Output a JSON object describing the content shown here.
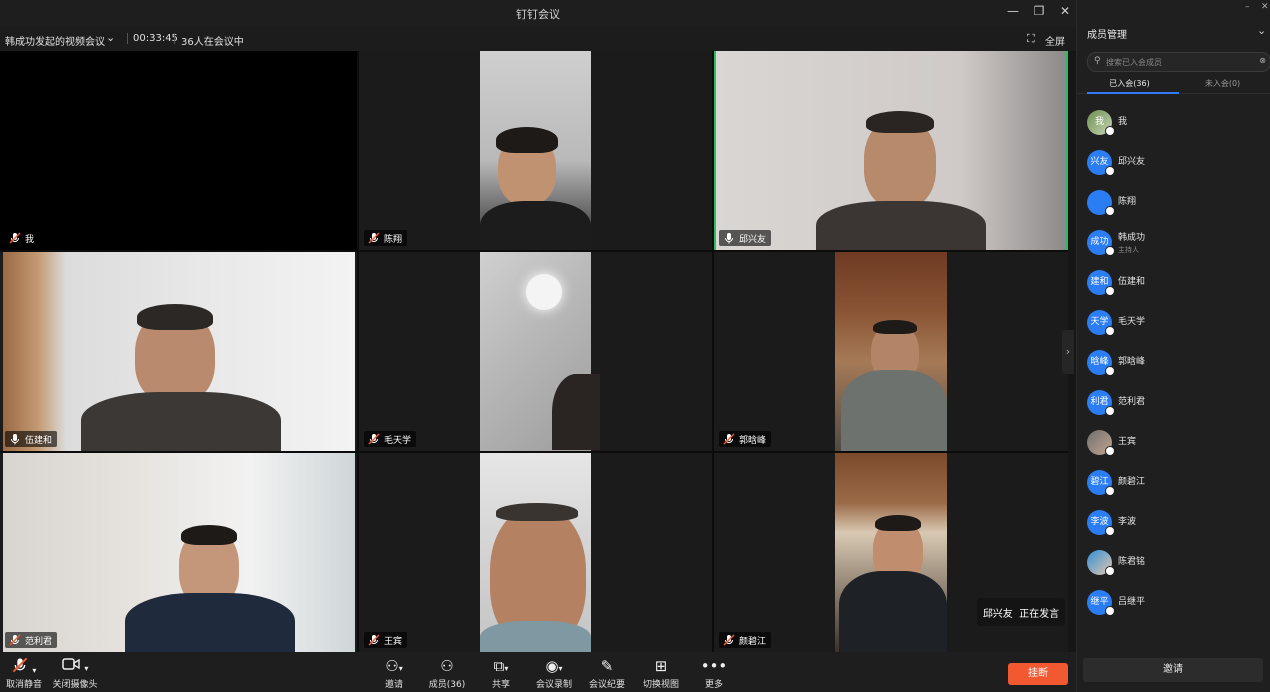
{
  "window": {
    "title": "钉钉会议",
    "minimize_icon": "minimize-icon",
    "restore_icon": "restore-icon",
    "close_icon": "close-icon"
  },
  "infobar": {
    "meeting_name": "韩成功发起的视频会议",
    "duration": "00:33:45",
    "participant_count_text": "36人在会议中",
    "fullscreen_label": "全屏"
  },
  "grid": {
    "tiles": [
      {
        "name": "我"
      },
      {
        "name": "陈翔"
      },
      {
        "name": "邱兴友"
      },
      {
        "name": "伍建和"
      },
      {
        "name": "毛天学"
      },
      {
        "name": "郭晗峰"
      },
      {
        "name": "范利君"
      },
      {
        "name": "王宾"
      },
      {
        "name": "颜碧江"
      }
    ]
  },
  "speaking": {
    "name": "邱兴友",
    "status": "正在发言"
  },
  "toolbar": {
    "mute_label": "取消静音",
    "camera_label": "关闭摄像头",
    "invite_label": "邀请",
    "members_label": "成员(36)",
    "share_label": "共享",
    "record_label": "会议录制",
    "minutes_label": "会议纪要",
    "switch_view_label": "切换视图",
    "more_label": "更多",
    "end_label": "挂断"
  },
  "panel": {
    "title": "成员管理",
    "search_placeholder": "搜索已入会成员",
    "tab_joined": "已入会(36)",
    "tab_not_joined": "未入会(0)",
    "invite_label": "邀请",
    "members": [
      {
        "avatar": "我",
        "name": "我",
        "role": ""
      },
      {
        "avatar": "兴友",
        "name": "邱兴友",
        "role": ""
      },
      {
        "avatar": "",
        "name": "陈翔",
        "role": ""
      },
      {
        "avatar": "成功",
        "name": "韩成功",
        "role": "主持人"
      },
      {
        "avatar": "建和",
        "name": "伍建和",
        "role": ""
      },
      {
        "avatar": "天学",
        "name": "毛天学",
        "role": ""
      },
      {
        "avatar": "晗峰",
        "name": "郭晗峰",
        "role": ""
      },
      {
        "avatar": "利君",
        "name": "范利君",
        "role": ""
      },
      {
        "avatar": "",
        "name": "王宾",
        "role": ""
      },
      {
        "avatar": "碧江",
        "name": "颜碧江",
        "role": ""
      },
      {
        "avatar": "李波",
        "name": "李波",
        "role": ""
      },
      {
        "avatar": "",
        "name": "陈君铭",
        "role": ""
      },
      {
        "avatar": "继平",
        "name": "吕继平",
        "role": ""
      }
    ]
  },
  "colors": {
    "accent_blue": "#2f7cf6",
    "active_speaker_border": "#2cbb63",
    "end_call": "#f25930"
  }
}
